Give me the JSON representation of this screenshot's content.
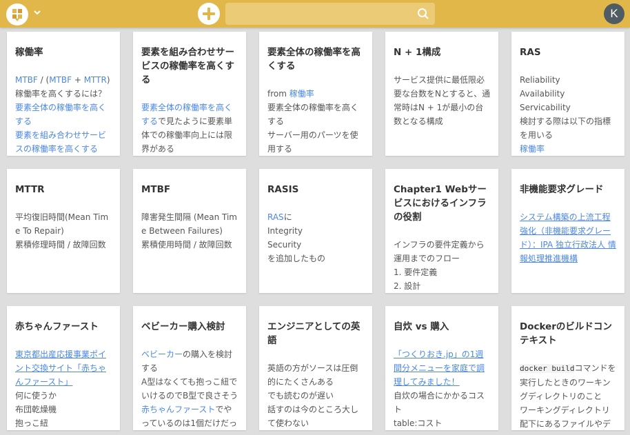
{
  "header": {
    "avatar_letter": "K",
    "search_value": "",
    "accent_color": "#e2b749"
  },
  "cards": [
    {
      "title": "稼働率",
      "body": [
        [
          {
            "t": "MTBF",
            "s": "link"
          },
          {
            "t": " / ("
          },
          {
            "t": "MTBF",
            "s": "link"
          },
          {
            "t": " + "
          },
          {
            "t": "MTTR",
            "s": "link"
          },
          {
            "t": ")"
          }
        ],
        [
          {
            "t": "稼働率を高くするには？"
          }
        ],
        [
          {
            "t": "要素全体の稼働率を高くする",
            "s": "link"
          }
        ],
        [
          {
            "t": "要素を組み合わせサービスの稼働率を高くする",
            "s": "link"
          }
        ]
      ]
    },
    {
      "title": "要素を組み合わせサービスの稼働率を高くする",
      "body": [
        [
          {
            "t": "要素全体の稼働率を高くする",
            "s": "link"
          },
          {
            "t": "で見たように要素単体での稼働率向上には限界がある"
          }
        ]
      ]
    },
    {
      "title": "要素全体の稼働率を高くする",
      "body": [
        [
          {
            "t": "from "
          },
          {
            "t": "稼働率",
            "s": "link"
          }
        ],
        [
          {
            "t": "要素全体の稼働率を高くする"
          }
        ],
        [
          {
            "t": "サーバー用のパーツを使用する"
          }
        ]
      ]
    },
    {
      "title": "N + 1構成",
      "body": [
        [
          {
            "t": "サービス提供に最低限必要な台数をNとすると、通常時はN + 1が最小の台数となる構成"
          }
        ]
      ]
    },
    {
      "title": "RAS",
      "body": [
        [
          {
            "t": "Reliability"
          }
        ],
        [
          {
            "t": "Availability"
          }
        ],
        [
          {
            "t": "Servicability"
          }
        ],
        [
          {
            "t": "検討する際は以下の指標を用いる"
          }
        ],
        [
          {
            "t": "稼働率",
            "s": "link"
          }
        ]
      ]
    },
    {
      "title": "MTTR",
      "body": [
        [
          {
            "t": "平均復旧時間(Mean Time To Repair)"
          }
        ],
        [
          {
            "t": "累積修理時間 / 故障回数"
          }
        ]
      ]
    },
    {
      "title": "MTBF",
      "body": [
        [
          {
            "t": "障害発生間隔 (Mean Time Between Failures)"
          }
        ],
        [
          {
            "t": "累積使用時間 / 故障回数"
          }
        ]
      ]
    },
    {
      "title": "RASIS",
      "body": [
        [
          {
            "t": "RAS",
            "s": "link"
          },
          {
            "t": "に"
          }
        ],
        [
          {
            "t": "Integrity"
          }
        ],
        [
          {
            "t": "Security"
          }
        ],
        [
          {
            "t": "を追加したもの"
          }
        ]
      ]
    },
    {
      "title": "Chapter1 Webサービスにおけるインフラの役割",
      "body": [
        [
          {
            "t": "インフラの要件定義から運用までのフロー"
          }
        ],
        [
          {
            "t": "1. 要件定義"
          }
        ],
        [
          {
            "t": "2. 設計"
          }
        ]
      ]
    },
    {
      "title": "非機能要求グレード",
      "body": [
        [
          {
            "t": "システム構築の上流工程強化（非機能要求グレード）：IPA 独立行政法人 情報処理推進機構",
            "s": "ulink"
          }
        ]
      ]
    },
    {
      "title": "赤ちゃんファースト",
      "body": [
        [
          {
            "t": "東京都出産応援事業ポイント交換サイト「赤ちゃんファースト」",
            "s": "ulink"
          }
        ],
        [
          {
            "t": "何に使うか"
          }
        ],
        [
          {
            "t": "布団乾燥機"
          }
        ],
        [
          {
            "t": "抱っこ紐"
          }
        ]
      ]
    },
    {
      "title": "ベビーカー購入検討",
      "body": [
        [
          {
            "t": "ベビーカー",
            "s": "link"
          },
          {
            "t": "の購入を検討する"
          }
        ],
        [
          {
            "t": "A型はなくても抱っこ紐でいけるのでB型で良さそう"
          }
        ],
        [
          {
            "t": "赤ちゃんファースト",
            "s": "link"
          },
          {
            "t": "でやっているのは1個だけだっ"
          }
        ]
      ]
    },
    {
      "title": "エンジニアとしての英語",
      "body": [
        [
          {
            "t": "英語の方がソースは圧倒的にたくさんある"
          }
        ],
        [
          {
            "t": "でも読むのが遅い"
          }
        ],
        [
          {
            "t": "話すのは今のところ大して使わない"
          }
        ]
      ]
    },
    {
      "title": "自炊 vs 購入",
      "body": [
        [
          {
            "t": "「つくりおき.jp」の1週間分メニューを家庭で調理してみました！",
            "s": "ulink"
          }
        ],
        [
          {
            "t": "自炊の場合にかかるコスト"
          }
        ],
        [
          {
            "t": "table:コスト"
          }
        ]
      ]
    },
    {
      "title": "Dockerのビルドコンテキスト",
      "body": [
        [
          {
            "t": "docker build",
            "s": "code"
          },
          {
            "t": "コマンドを実行したときのワーキングディレクトリのこと"
          }
        ],
        [
          {
            "t": "ワーキングディレクトリ配下にあるファイルやデ"
          }
        ]
      ]
    }
  ]
}
